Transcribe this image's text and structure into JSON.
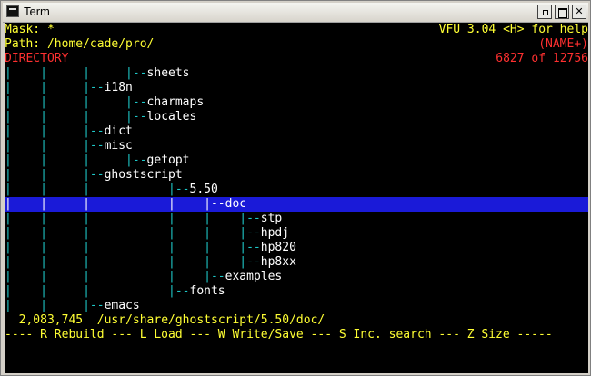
{
  "window": {
    "title": "Term"
  },
  "header": {
    "mask_label": "Mask:",
    "mask_value": "*",
    "app_version": "VFU 3.04 <H> for help",
    "path_label": "Path:",
    "path_value": "/home/cade/pro/",
    "sort_mode": "(NAME+)",
    "view_mode": "DIRECTORY",
    "position_text": "6827 of 12756"
  },
  "tree": {
    "rows": [
      {
        "guides": "|    |     |     |--",
        "name": "sheets"
      },
      {
        "guides": "|    |     |--",
        "name": "i18n"
      },
      {
        "guides": "|    |     |     |--",
        "name": "charmaps"
      },
      {
        "guides": "|    |     |     |--",
        "name": "locales"
      },
      {
        "guides": "|    |     |--",
        "name": "dict"
      },
      {
        "guides": "|    |     |--",
        "name": "misc"
      },
      {
        "guides": "|    |     |     |--",
        "name": "getopt"
      },
      {
        "guides": "|    |     |--",
        "name": "ghostscript"
      },
      {
        "guides": "|    |     |           |--",
        "name": "5.50"
      },
      {
        "guides": "|    |     |           |    |--",
        "name": "doc"
      },
      {
        "guides": "|    |     |           |    |    |--",
        "name": "stp"
      },
      {
        "guides": "|    |     |           |    |    |--",
        "name": "hpdj"
      },
      {
        "guides": "|    |     |           |    |    |--",
        "name": "hp820"
      },
      {
        "guides": "|    |     |           |    |    |--",
        "name": "hp8xx"
      },
      {
        "guides": "|    |     |           |    |--",
        "name": "examples"
      },
      {
        "guides": "|    |     |           |--",
        "name": "fonts"
      },
      {
        "guides": "|    |     |--",
        "name": "emacs"
      }
    ],
    "selected_index": 9
  },
  "status": {
    "size": "2,083,745",
    "current_path": "/usr/share/ghostscript/5.50/doc/"
  },
  "commands": {
    "text": "---- R Rebuild --- L Load --- W Write/Save --- S Inc. search --- Z Size -----"
  },
  "colors": {
    "background": "#000000",
    "header_text": "#ffff33",
    "alert_text": "#ff3030",
    "tree_guides": "#1ec8c8",
    "selection": "#1a1ad8"
  }
}
